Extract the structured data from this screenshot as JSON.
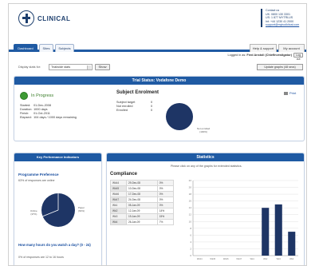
{
  "brand": {
    "logo_text": "CLINICAL"
  },
  "contact": {
    "title": "Contact us",
    "lines": [
      "UK: 0800 130 3301",
      "US: 1 877 MYTRLUS",
      "Int: +44 1230 41 2000"
    ],
    "email": "support@mytoolkitcal.com"
  },
  "tabs": [
    {
      "label": "Dashboard",
      "active": true
    },
    {
      "label": "Sites",
      "active": false
    },
    {
      "label": "Subjects",
      "active": false
    }
  ],
  "top_right": {
    "help": "Help & support",
    "account": "My account"
  },
  "session": {
    "prefix": "Logged in as:",
    "user": "Fred Anstoli (ChiefInvestigator)",
    "logout": "Log out"
  },
  "display": {
    "label": "Display stats for:",
    "selected": "Trialwide stats",
    "show_button": "Show",
    "update_button": "Update graphs (48 secs)"
  },
  "trial": {
    "title": "Trial Status: Vodafone Demo",
    "status": "In Progress",
    "details": [
      {
        "k": "Started:",
        "v": "01-Dec-2008"
      },
      {
        "k": "Duration:",
        "v": "1000 days"
      },
      {
        "k": "Finish:",
        "v": "01-Oct-2011"
      },
      {
        "k": "Elapsed:",
        "v": "104 days / 1000 days remaining"
      }
    ],
    "enrolment": {
      "title": "Subject Enrolment",
      "rows": [
        {
          "k": "Subject target",
          "v": "0"
        },
        {
          "k": "Not enrolled",
          "v": "0"
        },
        {
          "k": "Enrolled",
          "v": "0"
        }
      ],
      "pie_label_lines": [
        "Not enrolled",
        "(100%)"
      ],
      "not_enrolled_fraction": 1.0
    },
    "print": "Print"
  },
  "kpi": {
    "title": "Key Performance Indicators",
    "progress_title": "Programme Preference",
    "progress_sub": "63% of responses are online",
    "pie": {
      "left_label_lines": [
        "Online",
        "(37%)"
      ],
      "right_label_lines": [
        "Paper",
        "(63%)"
      ]
    },
    "question_title": "How many hours do you watch a day? (0 - 24)",
    "question_sub": "0% of responses are 12 to 16 hours"
  },
  "statistics": {
    "title": "Statistics",
    "hint": "Please click on any of the graphs for extended statistics.",
    "compliance_title": "Compliance",
    "table": [
      [
        "Wk44",
        "29-Dec-08",
        "0%"
      ],
      [
        "Wk45",
        "10-Dec-08",
        "0%"
      ],
      [
        "Wk46",
        "17-Dec-08",
        "0%"
      ],
      [
        "Wk47",
        "24-Dec-08",
        "0%"
      ],
      [
        "Wk1",
        "05-Jan-09",
        "0%"
      ],
      [
        "Wk2",
        "12-Jan-09",
        "14%"
      ],
      [
        "Wk3",
        "19-Jan-09",
        "15%"
      ],
      [
        "Wk4",
        "26-Jan-09",
        "7%"
      ]
    ]
  },
  "chart_data": {
    "type": "bar",
    "categories": [
      "Wk44",
      "Wk45",
      "Wk46",
      "Wk47",
      "Wk1",
      "Wk2",
      "Wk3",
      "Wk4"
    ],
    "values": [
      0,
      0,
      0,
      0,
      0,
      14,
      15,
      7
    ],
    "ylim": [
      0,
      22
    ],
    "yticks": [
      0,
      2,
      4,
      6,
      8,
      10,
      12,
      14,
      16,
      18,
      20,
      22
    ],
    "grid": true,
    "color": "#1e3565"
  }
}
